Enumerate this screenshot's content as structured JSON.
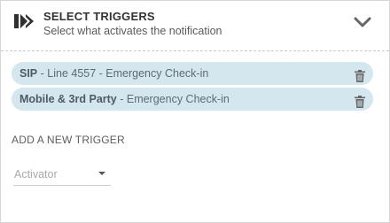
{
  "header": {
    "icon": "double-chevron-right-icon",
    "title": "SELECT TRIGGERS",
    "subtitle": "Select what activates the notification",
    "collapse_icon": "chevron-down-icon"
  },
  "triggers": [
    {
      "name": "SIP",
      "detail": " - Line 4557 - Emergency Check-in",
      "icon": "trash-icon"
    },
    {
      "name": "Mobile & 3rd Party",
      "detail": " - Emergency Check-in",
      "icon": "trash-icon"
    }
  ],
  "add_trigger": {
    "label": "ADD A NEW TRIGGER",
    "select_placeholder": "Activator"
  },
  "colors": {
    "pill_background": "#d5e7ee",
    "text": "#333333"
  }
}
